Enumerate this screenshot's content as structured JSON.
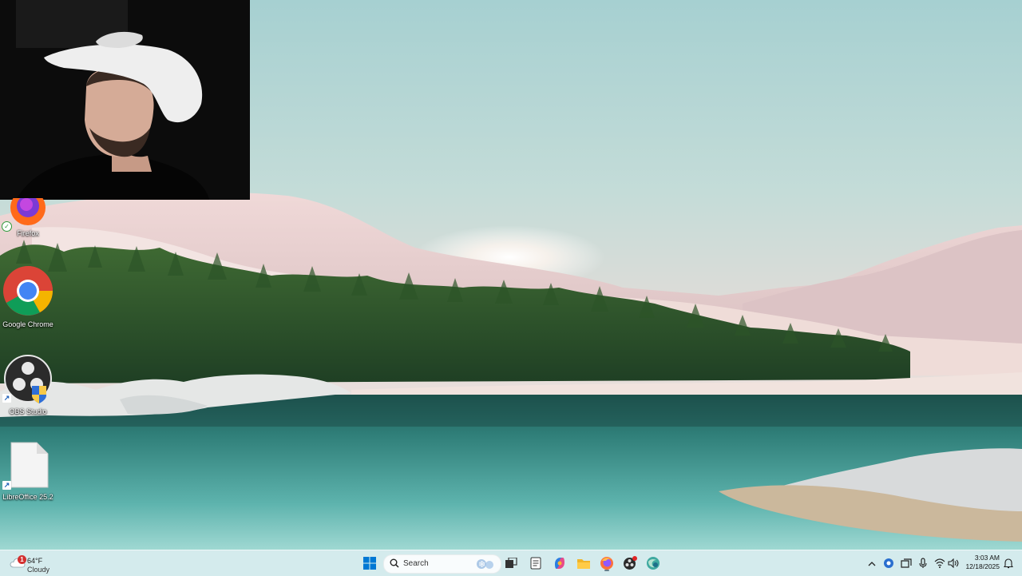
{
  "desktop": {
    "icons": [
      {
        "name": "firefox",
        "label": "Firefox",
        "icon": "firefox-icon",
        "badge": "sync-check-icon"
      },
      {
        "name": "google-chrome",
        "label": "Google Chrome",
        "icon": "chrome-icon"
      },
      {
        "name": "obs-studio",
        "label": "OBS Studio",
        "icon": "obs-icon",
        "badge": "shortcut-arrow-icon"
      },
      {
        "name": "libreoffice",
        "label": "LibreOffice 25.2",
        "icon": "document-icon",
        "badge": "shortcut-arrow-icon"
      }
    ]
  },
  "taskbar": {
    "weather": {
      "temp": "64°F",
      "condition": "Cloudy",
      "alert_count": "1",
      "icon": "cloud-icon"
    },
    "start_icon": "windows-start-icon",
    "search": {
      "placeholder": "Search",
      "icon": "search-icon"
    },
    "pinned": [
      {
        "name": "task-view",
        "icon": "task-view-icon"
      },
      {
        "name": "notepad",
        "icon": "notepad-icon"
      },
      {
        "name": "copilot",
        "icon": "copilot-icon"
      },
      {
        "name": "file-explorer",
        "icon": "folder-icon"
      },
      {
        "name": "firefox",
        "icon": "firefox-icon",
        "active": true
      },
      {
        "name": "obs-studio",
        "icon": "obs-icon",
        "recording": true
      },
      {
        "name": "edge-dev",
        "icon": "globe-icon"
      }
    ],
    "tray": {
      "icons": [
        "chevron-up-icon",
        "meet-now-icon",
        "onedrive-icon",
        "sync-icon",
        "microphone-icon",
        "wifi-icon",
        "speaker-icon"
      ],
      "time": "3:03 AM",
      "date": "12/18/2025",
      "notification_icon": "notification-bell-icon"
    }
  },
  "colors": {
    "taskbar_bg": "#d6ecee",
    "accent_blue": "#0078d4",
    "sky_top": "#a9d3d4",
    "lake": "#3a8f8c"
  }
}
